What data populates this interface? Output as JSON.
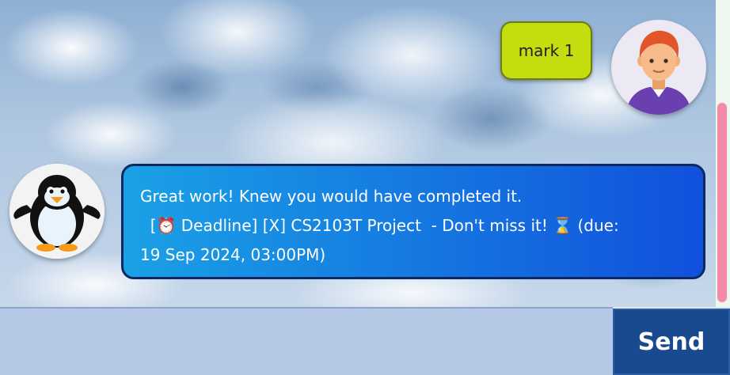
{
  "conversation": {
    "user_message": "mark 1",
    "bot_message": "Great work! Knew you would have completed it.\n  [⏰ Deadline] [X] CS2103T Project  - Don't miss it! ⌛ (due:\n19 Sep 2024, 03:00PM)"
  },
  "input": {
    "value": "",
    "placeholder": ""
  },
  "send_button": {
    "label": "Send"
  },
  "colors": {
    "user_bubble": "#c3dd0e",
    "bot_bubble_start": "#1aa1e6",
    "bot_bubble_end": "#1150dc",
    "send_button": "#1a4a8e",
    "input_bar": "#b5c8e6",
    "scrollbar": "#f58aa6"
  },
  "icons": {
    "user_avatar": "person-avatar-icon",
    "bot_avatar": "penguin-avatar-icon"
  }
}
